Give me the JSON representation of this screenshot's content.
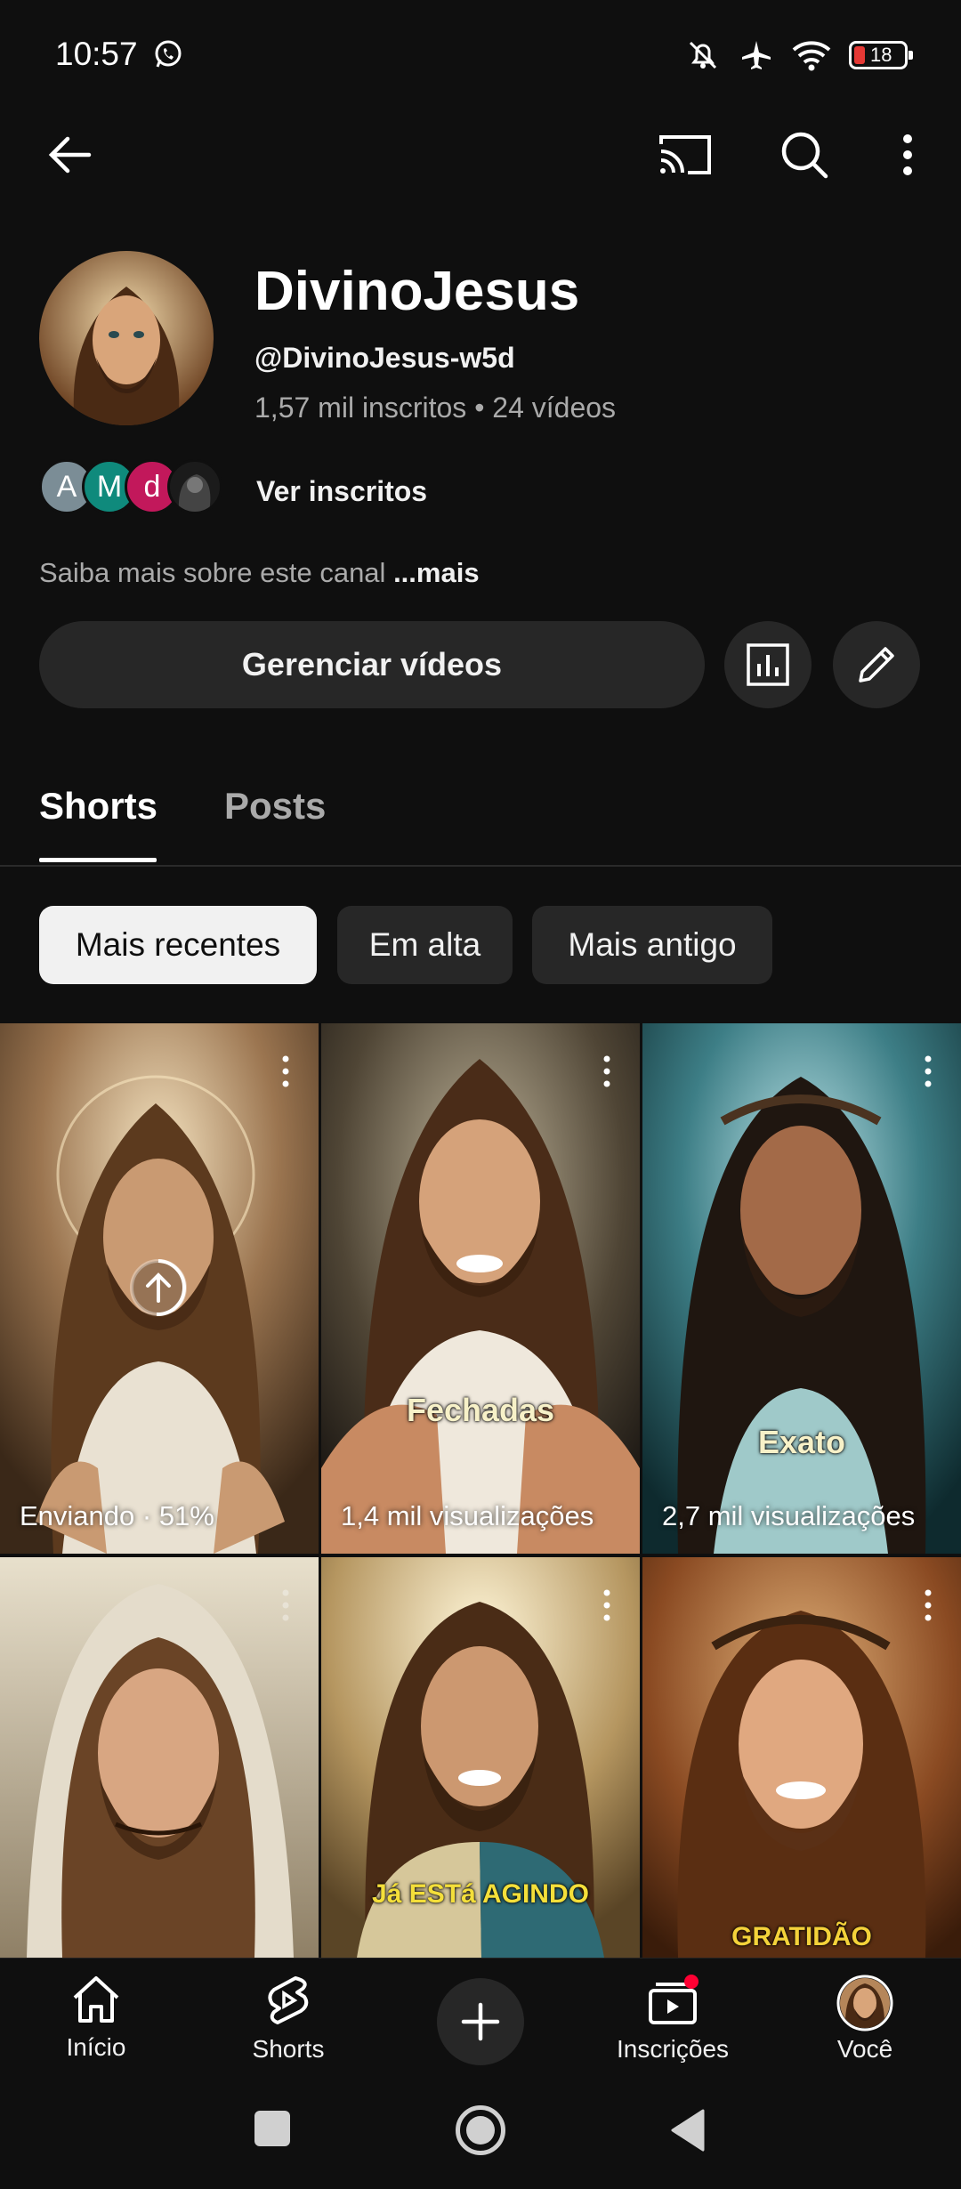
{
  "status_bar": {
    "time": "10:57",
    "battery": "18"
  },
  "channel": {
    "name": "DivinoJesus",
    "handle": "@DivinoJesus-w5d",
    "stats": "1,57 mil inscritos • 24 vídeos",
    "subscriber_avatars": [
      {
        "initial": "A",
        "color": "#7b8d96"
      },
      {
        "initial": "M",
        "color": "#0f8a7c"
      },
      {
        "initial": "d",
        "color": "#c2185b"
      },
      {
        "initial": "",
        "color": "#1b1b1b"
      }
    ],
    "view_subscribers": "Ver inscritos",
    "about_text": "Saiba mais sobre este canal",
    "about_more": "...mais",
    "manage_videos": "Gerenciar vídeos"
  },
  "tabs": [
    {
      "label": "Shorts",
      "active": true
    },
    {
      "label": "Posts",
      "active": false
    }
  ],
  "chips": [
    {
      "label": "Mais recentes",
      "selected": true
    },
    {
      "label": "Em alta",
      "selected": false
    },
    {
      "label": "Mais antigo",
      "selected": false
    }
  ],
  "shorts": [
    {
      "views": "Enviando · 51%",
      "caption": "",
      "uploading": true,
      "upload_progress": 0.51
    },
    {
      "views": "1,4 mil visualizações",
      "caption": "Fechadas"
    },
    {
      "views": "2,7 mil visualizações",
      "caption": "Exato"
    },
    {
      "views": "",
      "caption": ""
    },
    {
      "views": "",
      "caption": "Já ESTá AGINDO"
    },
    {
      "views": "",
      "caption": "GRATIDÃO"
    }
  ],
  "bottom_nav": {
    "home": "Início",
    "shorts": "Shorts",
    "subscriptions": "Inscrições",
    "you": "Você"
  },
  "colors": {
    "background": "#0f0f0f",
    "surface": "#272727",
    "notification": "#ff0033"
  }
}
